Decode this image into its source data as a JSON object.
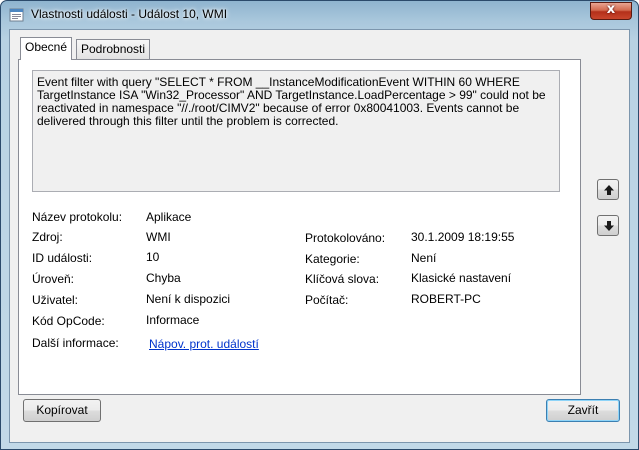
{
  "window": {
    "title": "Vlastnosti události - Událost 10, WMI",
    "close_glyph": "x"
  },
  "tabs": [
    {
      "label": "Obecné",
      "active": true
    },
    {
      "label": "Podrobnosti",
      "active": false
    }
  ],
  "message": "Event filter with query \"SELECT * FROM __InstanceModificationEvent WITHIN 60 WHERE TargetInstance ISA \"Win32_Processor\" AND TargetInstance.LoadPercentage > 99\" could not be reactivated in namespace \"//./root/CIMV2\" because of error 0x80041003. Events cannot be delivered through this filter until the problem is corrected.",
  "details": {
    "log_name_label": "Název protokolu:",
    "log_name": "Aplikace",
    "source_label": "Zdroj:",
    "source": "WMI",
    "logged_label": "Protokolováno:",
    "logged": "30.1.2009 18:19:55",
    "event_id_label": "ID události:",
    "event_id": "10",
    "category_label": "Kategorie:",
    "category": "Není",
    "level_label": "Úroveň:",
    "level": "Chyba",
    "keywords_label": "Klíčová slova:",
    "keywords": "Klasické nastavení",
    "user_label": "Uživatel:",
    "user": "Není k dispozici",
    "computer_label": "Počítač:",
    "computer": "ROBERT-PC",
    "opcode_label": "Kód OpCode:",
    "opcode": "Informace",
    "more_info_label": "Další informace:",
    "more_info_link": "Nápov. prot. událostí"
  },
  "buttons": {
    "copy": "Kopírovat",
    "close": "Zavřít"
  },
  "icons": {
    "app": "event-properties-icon",
    "up": "arrow-up-icon",
    "down": "arrow-down-icon"
  }
}
